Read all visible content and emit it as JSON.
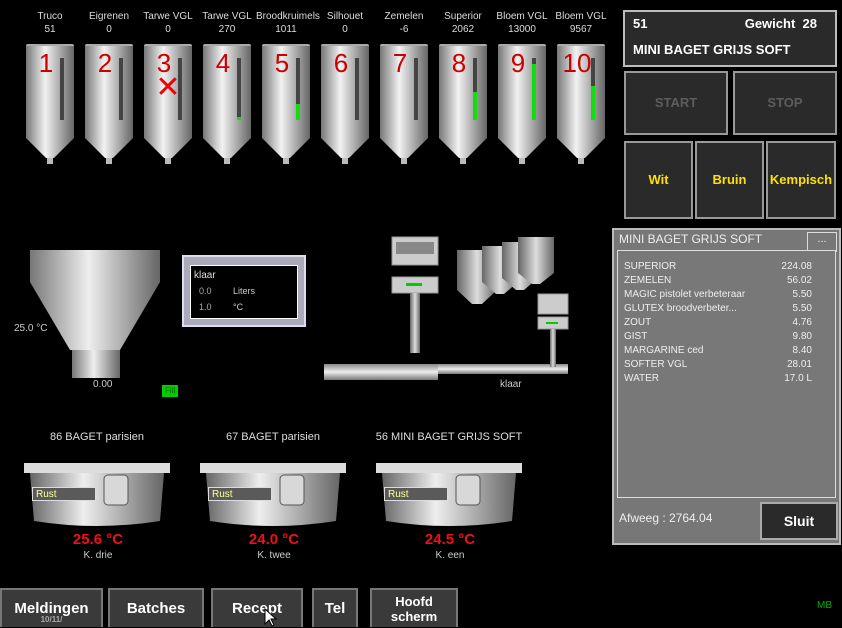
{
  "silos": [
    {
      "name": "Truco",
      "value": "51",
      "number": "1",
      "level": 0
    },
    {
      "name": "Eigrenen",
      "value": "0",
      "number": "2",
      "level": 0
    },
    {
      "name": "Tarwe VGL",
      "value": "0",
      "number": "3",
      "level": 0,
      "disabled": true
    },
    {
      "name": "Tarwe VGL",
      "value": "270",
      "number": "4",
      "level": 0.05
    },
    {
      "name": "Broodkruimels",
      "value": "1011",
      "number": "5",
      "level": 0.25
    },
    {
      "name": "Silhouet",
      "value": "0",
      "number": "6",
      "level": 0
    },
    {
      "name": "Zemelen",
      "value": "-6",
      "number": "7",
      "level": 0
    },
    {
      "name": "Superior",
      "value": "2062",
      "number": "8",
      "level": 0.45
    },
    {
      "name": "Bloem VGL",
      "value": "13000",
      "number": "9",
      "level": 0.9
    },
    {
      "name": "Bloem VGL",
      "value": "9567",
      "number": "10",
      "level": 0.55
    }
  ],
  "info": {
    "batch": "51",
    "weight_label": "Gewicht",
    "weight": "28",
    "product": "MINI BAGET GRIJS SOFT"
  },
  "controls": {
    "start": "START",
    "stop": "STOP",
    "wit": "Wit",
    "bruin": "Bruin",
    "kempisch": "Kempisch"
  },
  "water_tank": {
    "status": "klaar",
    "liters_value": "0.0",
    "liters_unit": "Liters",
    "temp_value": "1.0",
    "temp_unit": "°C"
  },
  "mixer": {
    "temp": "25.0 °C",
    "weight": "0.00",
    "indicator": "Fill"
  },
  "scale": {
    "status": "klaar"
  },
  "tanks": [
    {
      "title": "86 BAGET parisien",
      "status": "Rust",
      "temp": "25.6 °C",
      "label": "K. drie"
    },
    {
      "title": "67 BAGET parisien",
      "status": "Rust",
      "temp": "24.0 °C",
      "label": "K. twee"
    },
    {
      "title": "56 MINI BAGET GRIJS SOFT",
      "status": "Rust",
      "temp": "24.5 °C",
      "label": "K. een"
    }
  ],
  "recipe": {
    "title": "MINI BAGET GRIJS SOFT",
    "button": "...",
    "ingredients": [
      {
        "name": "SUPERIOR",
        "value": "224.08"
      },
      {
        "name": "ZEMELEN",
        "value": "56.02"
      },
      {
        "name": "MAGIC pistolet verbeteraar",
        "value": "5.50"
      },
      {
        "name": "GLUTEX broodverbeter...",
        "value": "5.50"
      },
      {
        "name": "ZOUT",
        "value": "4.76"
      },
      {
        "name": "GIST",
        "value": "9.80"
      },
      {
        "name": "MARGARINE ced",
        "value": "8.40"
      },
      {
        "name": "SOFTER VGL",
        "value": "28.01"
      },
      {
        "name": "WATER",
        "value": "17.0 L"
      }
    ],
    "afweeg": "Afweeg : 2764.04",
    "close": "Sluit"
  },
  "nav": {
    "meldingen": "Meldingen",
    "meldingen_sub": "10/11/",
    "batches": "Batches",
    "recept": "Recept",
    "tel": "Tel",
    "hoofd1": "Hoofd",
    "hoofd2": "scherm"
  },
  "footer": {
    "initials": "MB"
  }
}
